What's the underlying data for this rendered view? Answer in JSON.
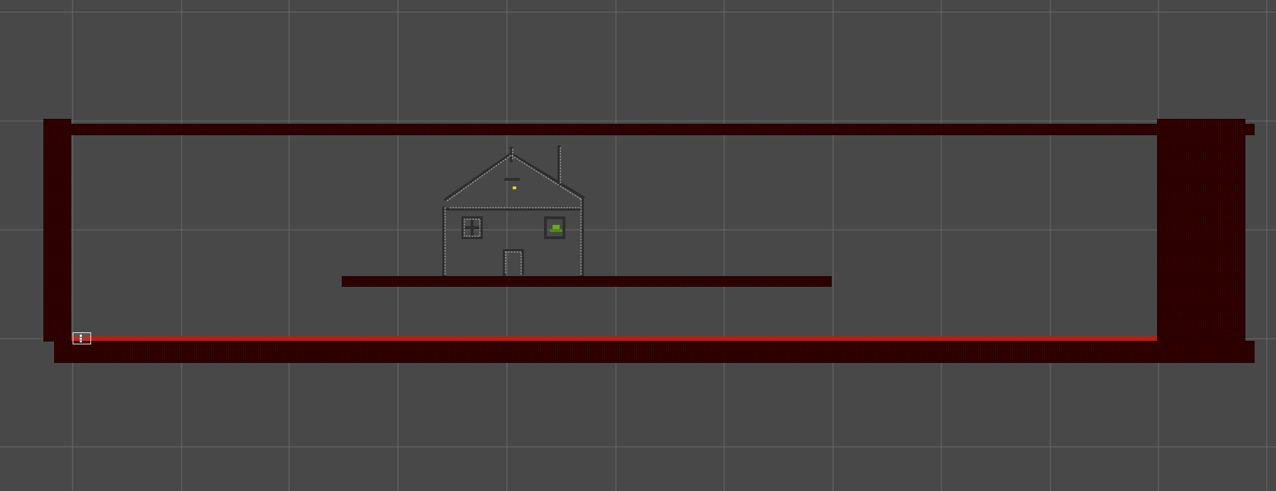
{
  "scene": {
    "view": "Scene",
    "colors": {
      "background": "#484848",
      "grid": "#6a6a6a",
      "wall": "#3a0000",
      "floor_edge": "#c21a0c",
      "sketch": "#9a9a9a",
      "sketch_dark": "#2e2e2e",
      "yellow_marker": "#d7d23a",
      "green_marker": "#6aa81f"
    },
    "objects": [
      {
        "name": "left-wall",
        "type": "tilemap-wall"
      },
      {
        "name": "ceiling",
        "type": "tilemap-wall"
      },
      {
        "name": "right-wall",
        "type": "tilemap-wall"
      },
      {
        "name": "floor",
        "type": "tilemap-wall"
      },
      {
        "name": "middle-platform",
        "type": "tilemap-wall"
      },
      {
        "name": "house-sketch",
        "type": "sprite"
      },
      {
        "name": "player-gizmo",
        "type": "selection"
      }
    ],
    "icons": [
      "selection-gizmo-icon",
      "yellow-dot-icon",
      "green-sprite-icon"
    ]
  }
}
